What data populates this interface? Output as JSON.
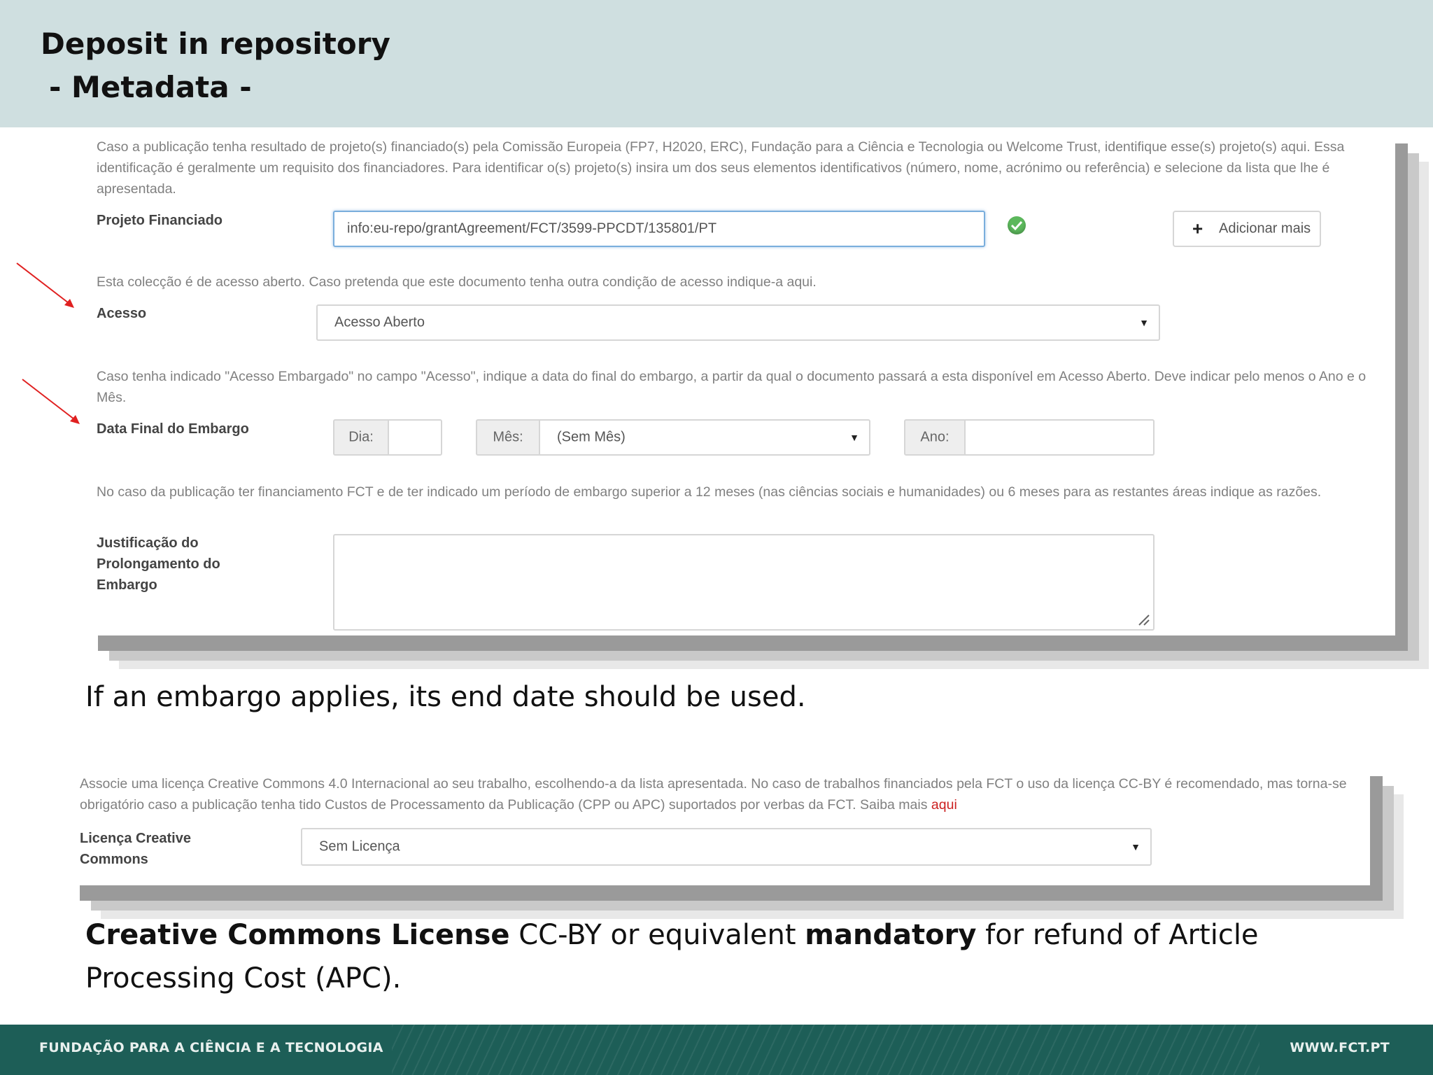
{
  "slide": {
    "title_line1": "Deposit in repository",
    "title_line2": "- Metadata -"
  },
  "form1": {
    "projeto_help": "Caso a publicação tenha resultado de projeto(s) financiado(s) pela Comissão Europeia (FP7, H2020, ERC), Fundação para a Ciência e Tecnologia ou Welcome Trust, identifique esse(s) projeto(s) aqui. Essa identificação é geralmente um requisito dos financiadores. Para identificar o(s) projeto(s) insira um dos seus elementos identificativos (número, nome, acrónimo ou referência) e selecione da lista que lhe é apresentada.",
    "projeto_label": "Projeto Financiado",
    "projeto_value": "info:eu-repo/grantAgreement/FCT/3599-PPCDT/135801/PT",
    "add_more_label": "Adicionar mais",
    "acesso_help": "Esta colecção é de acesso aberto. Caso pretenda que este documento tenha outra condição de acesso indique-a aqui.",
    "acesso_label": "Acesso",
    "acesso_value": "Acesso Aberto",
    "embargo_help": "Caso tenha indicado \"Acesso Embargado\" no campo \"Acesso\", indique a data do final do embargo, a partir da qual o documento passará a esta disponível em Acesso Aberto. Deve indicar pelo menos o Ano e o Mês.",
    "embargo_label": "Data Final do Embargo",
    "dia_label": "Dia:",
    "dia_value": "",
    "mes_label": "Mês:",
    "mes_value": "(Sem Mês)",
    "ano_label": "Ano:",
    "ano_value": "",
    "justificacao_help": "No caso da publicação ter financiamento FCT e de ter indicado um período de embargo superior a 12 meses (nas ciências sociais e humanidades) ou 6 meses para as restantes áreas indique as razões.",
    "justificacao_label": "Justificação do Prolongamento do Embargo",
    "justificacao_value": ""
  },
  "caption1": "If an embargo applies, its end date should be used.",
  "form2": {
    "licenca_help": "Associe uma licença Creative Commons 4.0 Internacional ao seu trabalho, escolhendo-a da lista apresentada. No caso de trabalhos financiados pela FCT o uso da licença CC-BY é recomendado, mas torna-se obrigatório caso a publicação tenha tido Custos de Processamento da Publicação (CPP ou APC) suportados por verbas da FCT. Saiba mais",
    "licenca_link": "aqui",
    "licenca_label": "Licença Creative Commons",
    "licenca_value": "Sem Licença"
  },
  "caption2": {
    "part1": "Creative Commons License",
    "part2": " CC-BY or equivalent ",
    "part3": "mandatory",
    "part4": " for refund of Article Processing Cost (APC)."
  },
  "footer": {
    "left": "FUNDAÇÃO PARA A CIÊNCIA E A TECNOLOGIA",
    "right": "WWW.FCT.PT"
  },
  "colors": {
    "header_bg": "#cfdfe0",
    "footer_bg": "#1d5e57",
    "link_red": "#cc2020",
    "check_green": "#5cb85c"
  },
  "icons": {
    "check": "check-circle-icon",
    "plus": "plus-icon",
    "caret": "caret-down-icon",
    "resize": "resize-grip-icon",
    "arrow": "red-arrow-icon"
  }
}
